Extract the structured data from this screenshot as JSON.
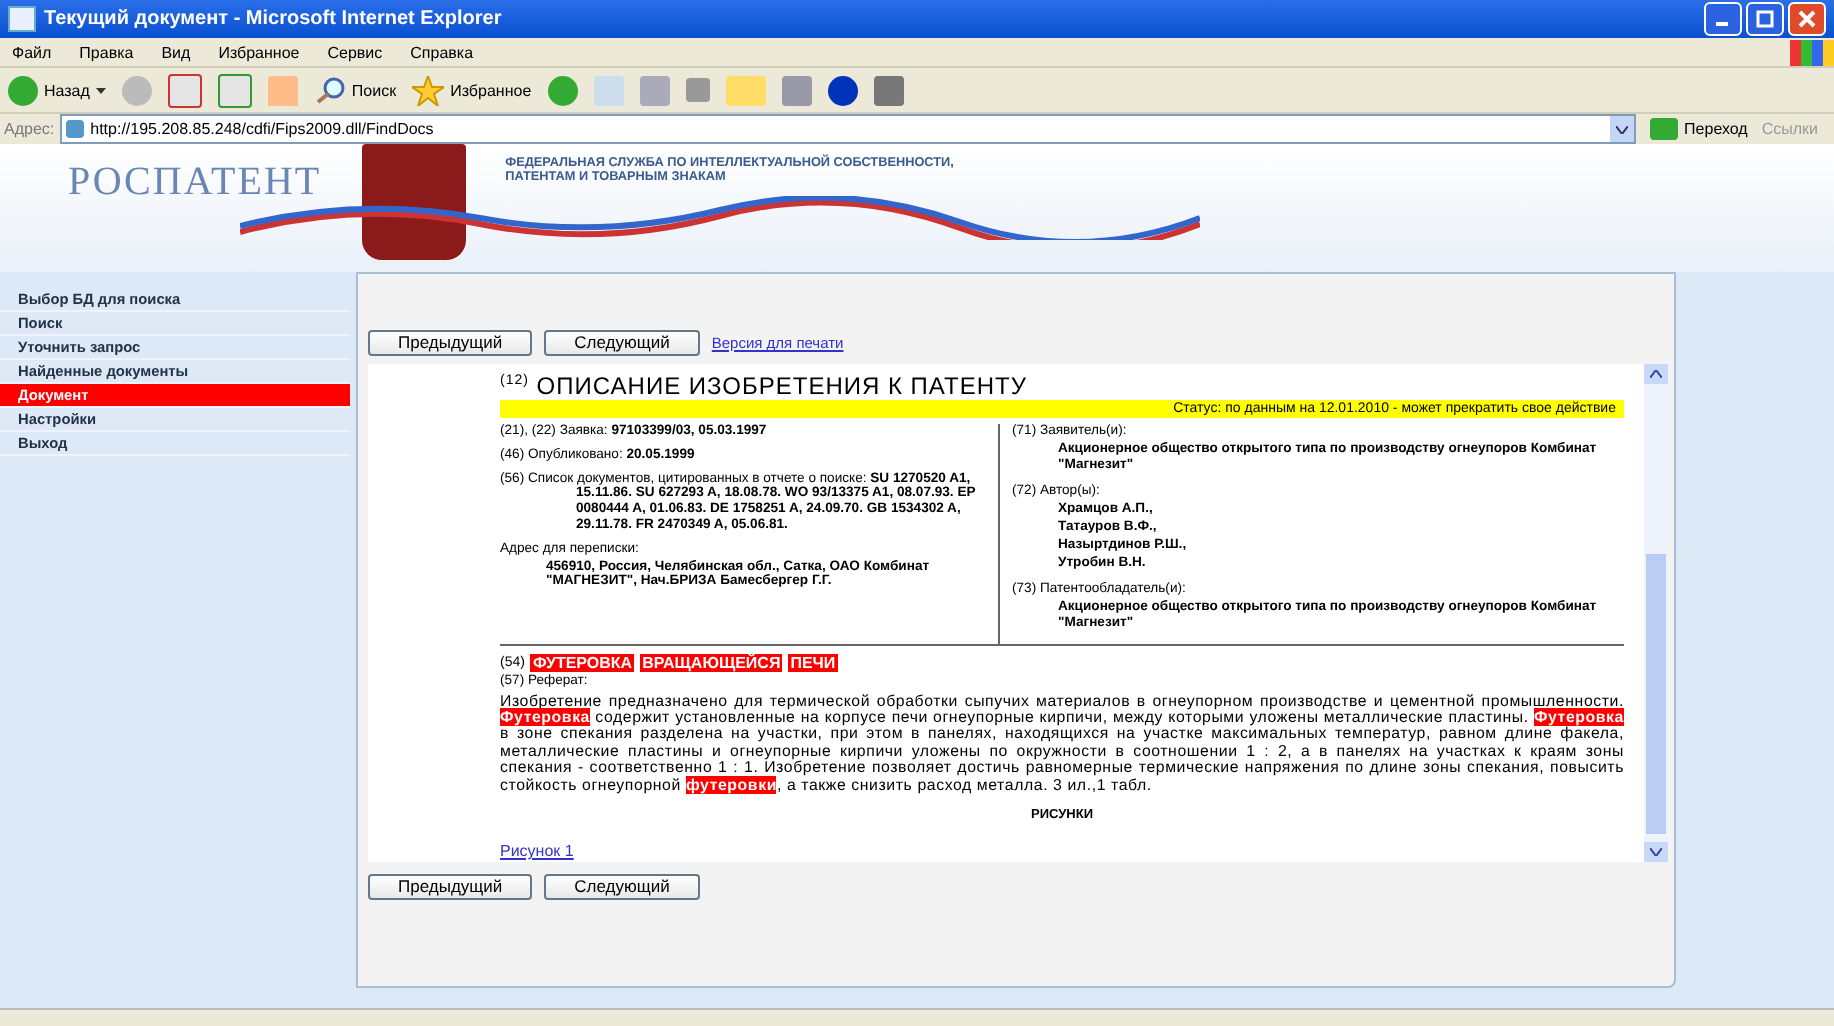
{
  "window": {
    "title": "Текущий документ - Microsoft Internet Explorer"
  },
  "menu": [
    "Файл",
    "Правка",
    "Вид",
    "Избранное",
    "Сервис",
    "Справка"
  ],
  "toolbar": {
    "back": "Назад",
    "search": "Поиск",
    "favorites": "Избранное"
  },
  "address_bar": {
    "label": "Адрес:",
    "value": "http://195.208.85.248/cdfi/Fips2009.dll/FindDocs",
    "go": "Переход",
    "links": "Ссылки"
  },
  "banner": {
    "logo": "РОСПАТЕНТ",
    "agency": [
      "ФЕДЕРАЛЬНАЯ СЛУЖБА ПО ИНТЕЛЛЕКТУАЛЬНОЙ СОБСТВЕННОСТИ,",
      "ПАТЕНТАМ И ТОВАРНЫМ ЗНАКАМ"
    ]
  },
  "sidebar": {
    "items": [
      {
        "label": "Выбор БД для поиска",
        "selected": false
      },
      {
        "label": "Поиск",
        "selected": false
      },
      {
        "label": "Уточнить запрос",
        "selected": false
      },
      {
        "label": "Найденные документы",
        "selected": false
      },
      {
        "label": "Документ",
        "selected": true
      },
      {
        "label": "Настройки",
        "selected": false
      },
      {
        "label": "Выход",
        "selected": false
      }
    ]
  },
  "top_buttons": [
    "Предыдущий",
    "Следующий"
  ],
  "print_link": "Версия для печати",
  "document": {
    "title": "$^{(12)}$ ОПИСАНИЕ ИЗОБРЕТЕНИЯ К ПАТЕНТУ",
    "status": "Статус: по данным на 12.01.2010 - может прекратить свое действие",
    "left_fields": [
      {
        "label": "(21), (22) Заявка:",
        "value": "97103399/03, 05.03.1997",
        "kind": "inline"
      },
      {
        "label": "(46) Опубликовано:",
        "value": "20.05.1999",
        "kind": "inline"
      },
      {
        "label": "(56) Список документов, цитированных в отчете о поиске:",
        "value": "SU 1270520 A1, 15.11.86. SU 627293 A, 18.08.78. WO 93/13375 A1, 08.07.93. EP 0080444 A, 01.06.83. DE 1758251 A, 24.09.70. GB 1534302 A, 29.11.78. FR 2470349 A, 05.06.81.",
        "kind": "inline"
      },
      {
        "label": "Адрес для переписки:",
        "value": "456910, Россия, Челябинская обл., Сатка, ОАО Комбинат \"МАГНЕЗИТ\", Нач.БРИЗА Бамесбергер Г.Г.",
        "kind": "block"
      }
    ],
    "right_fields": [
      {
        "label": "(71) Заявитель(и):",
        "values": [
          "Акционерное общество открытого типа по производству огнеупоров Комбинат \"Магнезит\""
        ]
      },
      {
        "label": "(72) Автор(ы):",
        "values": [
          "Храмцов А.П.,",
          "Татауров В.Ф.,",
          "Назыртдинов Р.Ш.,",
          "Утробин В.Н."
        ]
      },
      {
        "label": "(73) Патентообладатель(и):",
        "values": [
          "Акционерное общество открытого типа по производству огнеупоров Комбинат \"Магнезит\""
        ]
      }
    ],
    "name_label": "(54)",
    "name_words": [
      "ФУТЕРОВКА",
      "ВРАЩАЮЩЕЙСЯ",
      "ПЕЧИ"
    ],
    "abstract_label": "(57) Реферат:",
    "abstract": "Изобретение предназначено для термической обработки сыпучих материалов в огнеупорном производстве и цементной промышленности. **Футеровка** содержит установленные на корпусе печи огнеупорные кирпичи, между которыми уложены металлические пластины. **Футеровка** в зоне спекания разделена на участки, при этом в панелях, находящихся на участке максимальных температур, равном длине факела, металлические пластины и огнеупорные кирпичи уложены по окружности в соотношении 1 : 2, а в панелях на участках к краям зоны спекания - соответственно 1 : 1. Изобретение позволяет достичь равномерные термические напряжения по длине зоны спекания, повысить стойкость огнеупорной **футеровки**, а также снизить расход металла. 3 ил.,1 табл.",
    "figures_heading": "РИСУНКИ",
    "figure_link": "Рисунок 1"
  },
  "bottom_buttons": [
    "Предыдущий",
    "Следующий"
  ]
}
